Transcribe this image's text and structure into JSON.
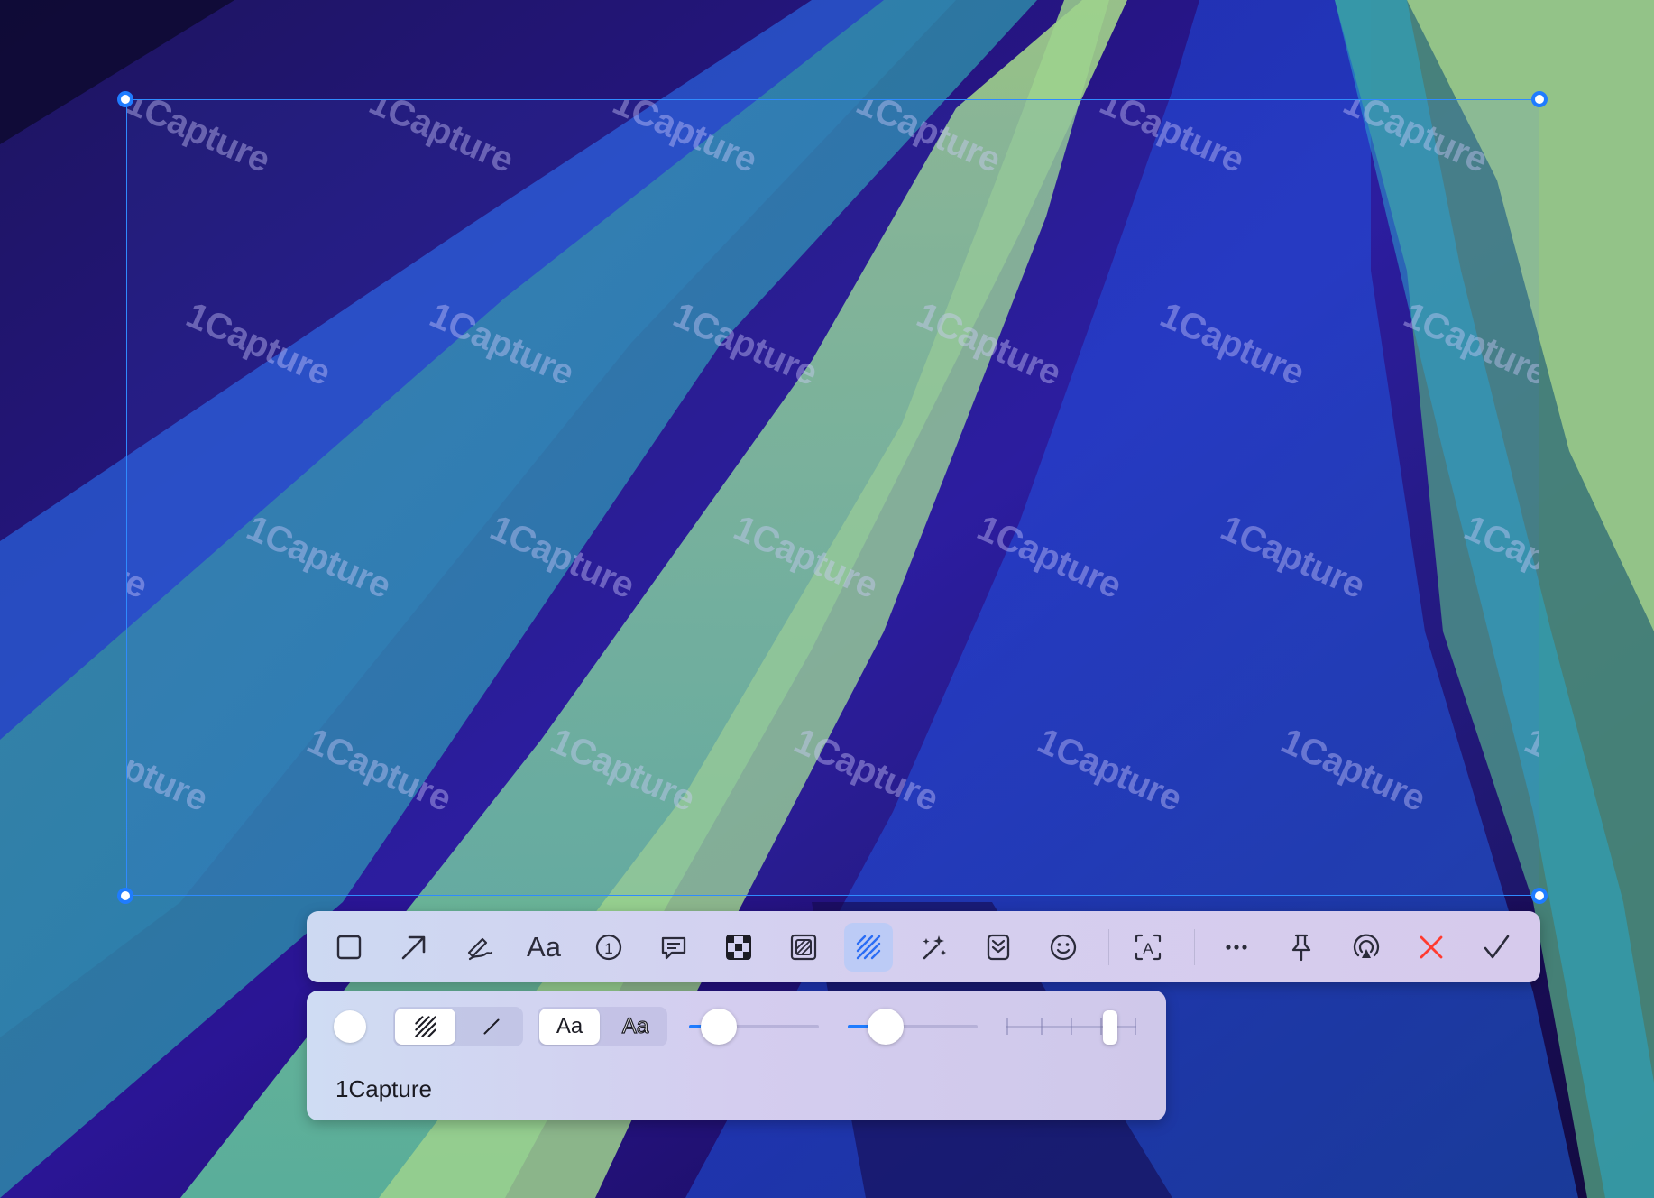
{
  "watermark": {
    "text": "1Capture"
  },
  "toolbar": {
    "tools": [
      {
        "id": "rectangle",
        "icon": "square-icon"
      },
      {
        "id": "arrow",
        "icon": "arrow-icon"
      },
      {
        "id": "pen",
        "icon": "pen-icon"
      },
      {
        "id": "text",
        "icon": "text-icon",
        "label": "Aa"
      },
      {
        "id": "step",
        "icon": "step-number-icon",
        "label": "1"
      },
      {
        "id": "callout",
        "icon": "speech-bubble-icon"
      },
      {
        "id": "mosaic",
        "icon": "mosaic-icon"
      },
      {
        "id": "blur",
        "icon": "blur-icon"
      },
      {
        "id": "watermark",
        "icon": "hatch-icon",
        "active": true
      },
      {
        "id": "magic",
        "icon": "magic-wand-icon"
      },
      {
        "id": "scroll",
        "icon": "scroll-capture-icon"
      },
      {
        "id": "emoji",
        "icon": "smiley-icon"
      },
      {
        "id": "ocr",
        "icon": "ocr-icon",
        "label": "A"
      },
      {
        "id": "more",
        "icon": "more-icon"
      },
      {
        "id": "pin",
        "icon": "pin-icon"
      },
      {
        "id": "share",
        "icon": "airdrop-icon"
      },
      {
        "id": "cancel",
        "icon": "close-icon"
      },
      {
        "id": "confirm",
        "icon": "checkmark-icon"
      }
    ]
  },
  "subpanel": {
    "color": "#ffffff",
    "pattern_options": [
      "hatch",
      "line"
    ],
    "pattern_selected": "hatch",
    "font_style_options": [
      {
        "label": "Aa",
        "style": "filled",
        "selected": true
      },
      {
        "label": "Aa",
        "style": "outline",
        "selected": false
      }
    ],
    "slider1_level": 0.23,
    "slider2_level": 0.29,
    "density_level": 0.8,
    "watermark_text": "1Capture"
  },
  "colors": {
    "accent": "#1f7cff",
    "cancel": "#ff3b30",
    "active_tool_bg": "#bccbf6"
  }
}
